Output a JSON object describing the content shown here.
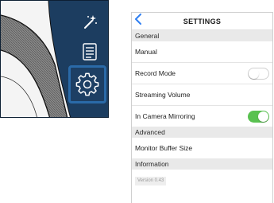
{
  "preview": {
    "buttons": [
      "wand-icon",
      "list-icon",
      "gear-icon"
    ]
  },
  "settings": {
    "back_icon": "chevron-left-icon",
    "title": "SETTINGS",
    "sections": {
      "general": "General",
      "advanced": "Advanced",
      "information": "Information"
    },
    "rows": {
      "manual": "Manual",
      "record_mode": "Record Mode",
      "streaming_volume": "Streaming Volume",
      "in_camera_mirroring": "In Camera Mirroring",
      "monitor_buffer_size": "Monitor Buffer Size"
    },
    "toggles": {
      "record_mode": "off",
      "in_camera_mirroring": "on"
    },
    "version": "Version 0.43"
  },
  "colors": {
    "accent": "#2f7ff2",
    "toggle_on": "#59c150",
    "preview_bg": "#1c3d60",
    "highlight": "#2a6aa8"
  }
}
